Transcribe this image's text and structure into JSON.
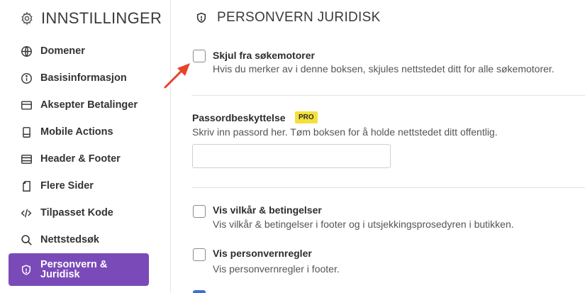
{
  "sidebar": {
    "title": "INNSTILLINGER",
    "title_icon": "gear-icon",
    "items": [
      {
        "label": "Domener",
        "icon": "globe-icon"
      },
      {
        "label": "Basisinformasjon",
        "icon": "info-icon"
      },
      {
        "label": "Aksepter Betalinger",
        "icon": "credit-card-icon"
      },
      {
        "label": "Mobile Actions",
        "icon": "mobile-icon"
      },
      {
        "label": "Header & Footer",
        "icon": "layout-icon"
      },
      {
        "label": "Flere Sider",
        "icon": "pages-icon"
      },
      {
        "label": "Tilpasset Kode",
        "icon": "code-icon"
      },
      {
        "label": "Nettstedsøk",
        "icon": "search-icon"
      },
      {
        "label": "Personvern & Juridisk",
        "icon": "shield-icon",
        "active": true
      }
    ],
    "active_color": "#7a4bb8"
  },
  "main": {
    "title": "PERSONVERN JURIDISK",
    "title_icon": "shield-icon",
    "hide_search": {
      "title": "Skjul fra søkemotorer",
      "description": "Hvis du merker av i denne boksen, skjules nettstedet ditt for alle søkemotorer.",
      "checked": false
    },
    "password": {
      "title": "Passordbeskyttelse",
      "badge": "PRO",
      "badge_color": "#f5e03a",
      "description": "Skriv inn passord her. Tøm boksen for å holde nettstedet ditt offentlig.",
      "value": ""
    },
    "terms": {
      "title": "Vis vilkår & betingelser",
      "description": "Vis vilkår & betingelser i footer og i utsjekkingsprosedyren i butikken.",
      "checked": false
    },
    "privacy": {
      "title": "Vis personvernregler",
      "description": "Vis personvernregler i footer.",
      "checked": false
    }
  },
  "annotation": {
    "arrow_color": "#e8442a"
  }
}
